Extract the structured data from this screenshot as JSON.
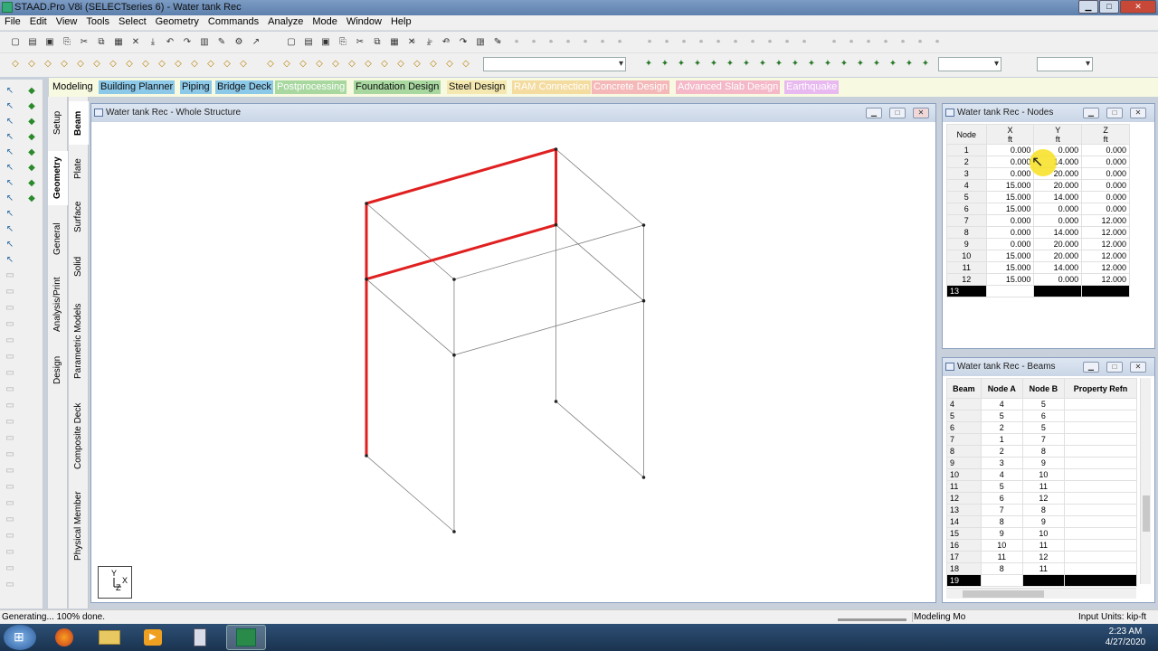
{
  "window": {
    "title": "STAAD.Pro V8i (SELECTseries 6) - Water tank Rec"
  },
  "menu": [
    "File",
    "Edit",
    "View",
    "Tools",
    "Select",
    "Geometry",
    "Commands",
    "Analyze",
    "Mode",
    "Window",
    "Help"
  ],
  "modes": {
    "label": "Modeling",
    "items": [
      {
        "label": "Building Planner",
        "bg": "#8cc8e8"
      },
      {
        "label": "Piping",
        "bg": "#8cc8e8"
      },
      {
        "label": "Bridge Deck",
        "bg": "#8cc8e8"
      },
      {
        "label": "Postprocessing",
        "bg": "#a8d8a0",
        "muted": true
      },
      {
        "label": "Foundation Design",
        "bg": "#a8d8a0"
      },
      {
        "label": "Steel Design",
        "bg": "#f4e8b0"
      },
      {
        "label": "RAM Connection",
        "bg": "#f4dca0",
        "muted": true
      },
      {
        "label": "Concrete Design",
        "bg": "#f4b8b8",
        "muted": true
      },
      {
        "label": "Advanced Slab Design",
        "bg": "#f4b8c8",
        "muted": true
      },
      {
        "label": "Earthquake",
        "bg": "#e8b8f0",
        "muted": true
      }
    ]
  },
  "vtabs_outer": [
    "Setup",
    "Geometry",
    "General",
    "Analysis/Print",
    "Design"
  ],
  "vtabs_inner": [
    "Beam",
    "Plate",
    "Surface",
    "Solid",
    "Parametric Models",
    "Composite Deck",
    "Physical Member"
  ],
  "structure_window": {
    "title": "Water tank Rec - Whole Structure"
  },
  "axis_labels": {
    "y": "Y",
    "x": "X",
    "z": "Z"
  },
  "nodes_window": {
    "title": "Water tank Rec - Nodes",
    "headers": [
      {
        "name": "Node",
        "unit": ""
      },
      {
        "name": "X",
        "unit": "ft"
      },
      {
        "name": "Y",
        "unit": "ft"
      },
      {
        "name": "Z",
        "unit": "ft"
      }
    ],
    "rows": [
      [
        "1",
        "0.000",
        "0.000",
        "0.000"
      ],
      [
        "2",
        "0.000",
        "14.000",
        "0.000"
      ],
      [
        "3",
        "0.000",
        "20.000",
        "0.000"
      ],
      [
        "4",
        "15.000",
        "20.000",
        "0.000"
      ],
      [
        "5",
        "15.000",
        "14.000",
        "0.000"
      ],
      [
        "6",
        "15.000",
        "0.000",
        "0.000"
      ],
      [
        "7",
        "0.000",
        "0.000",
        "12.000"
      ],
      [
        "8",
        "0.000",
        "14.000",
        "12.000"
      ],
      [
        "9",
        "0.000",
        "20.000",
        "12.000"
      ],
      [
        "10",
        "15.000",
        "20.000",
        "12.000"
      ],
      [
        "11",
        "15.000",
        "14.000",
        "12.000"
      ],
      [
        "12",
        "15.000",
        "0.000",
        "12.000"
      ]
    ],
    "new_row": "13"
  },
  "beams_window": {
    "title": "Water tank Rec - Beams",
    "headers": [
      "Beam",
      "Node A",
      "Node B",
      "Property Refn"
    ],
    "rows": [
      [
        "4",
        "4",
        "5",
        ""
      ],
      [
        "5",
        "5",
        "6",
        ""
      ],
      [
        "6",
        "2",
        "5",
        ""
      ],
      [
        "7",
        "1",
        "7",
        ""
      ],
      [
        "8",
        "2",
        "8",
        ""
      ],
      [
        "9",
        "3",
        "9",
        ""
      ],
      [
        "10",
        "4",
        "10",
        ""
      ],
      [
        "11",
        "5",
        "11",
        ""
      ],
      [
        "12",
        "6",
        "12",
        ""
      ],
      [
        "13",
        "7",
        "8",
        ""
      ],
      [
        "14",
        "8",
        "9",
        ""
      ],
      [
        "15",
        "9",
        "10",
        ""
      ],
      [
        "16",
        "10",
        "11",
        ""
      ],
      [
        "17",
        "11",
        "12",
        ""
      ],
      [
        "18",
        "8",
        "11",
        ""
      ]
    ],
    "new_row": "19"
  },
  "status": {
    "left": "Generating... 100% done.",
    "mode": "Modeling Mo",
    "units": "Input Units:  kip-ft"
  },
  "clock": {
    "time": "2:23 AM",
    "date": "4/27/2020"
  },
  "colors": {
    "highlight": "#e02020",
    "member": "#808080",
    "accent": "#f8e020"
  }
}
